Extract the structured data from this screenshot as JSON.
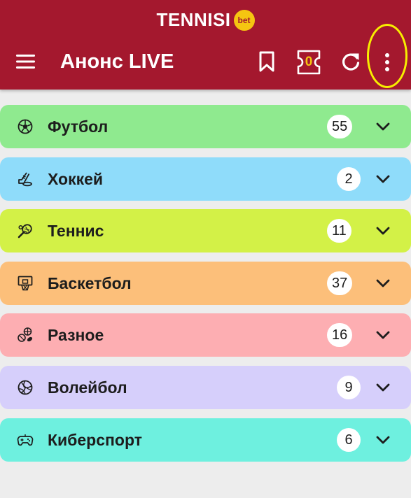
{
  "brand": {
    "name": "TENNISI",
    "badge": "bet"
  },
  "header": {
    "title": "Анонс LIVE",
    "betslip_count": "0",
    "icons": [
      "menu-icon",
      "bookmark-icon",
      "betslip-icon",
      "refresh-icon",
      "more-vertical-icon"
    ]
  },
  "colors": {
    "header_bg": "#a4182e",
    "accent_yellow": "#f5c511",
    "highlight": "#f7ee00",
    "page_bg": "#ededed"
  },
  "sports": [
    {
      "name": "Футбол",
      "count": "55",
      "color": "#8fea8f",
      "icon": "soccer-ball-icon"
    },
    {
      "name": "Хоккей",
      "count": "2",
      "color": "#8fdcfa",
      "icon": "hockey-icon"
    },
    {
      "name": "Теннис",
      "count": "11",
      "color": "#d3f147",
      "icon": "tennis-icon"
    },
    {
      "name": "Баскетбол",
      "count": "37",
      "color": "#fcbf7a",
      "icon": "basketball-hoop-icon"
    },
    {
      "name": "Разное",
      "count": "16",
      "color": "#fdaeb2",
      "icon": "misc-sports-icon"
    },
    {
      "name": "Волейбол",
      "count": "9",
      "color": "#d6cffb",
      "icon": "volleyball-icon"
    },
    {
      "name": "Киберспорт",
      "count": "6",
      "color": "#6ef0df",
      "icon": "gamepad-icon"
    }
  ]
}
